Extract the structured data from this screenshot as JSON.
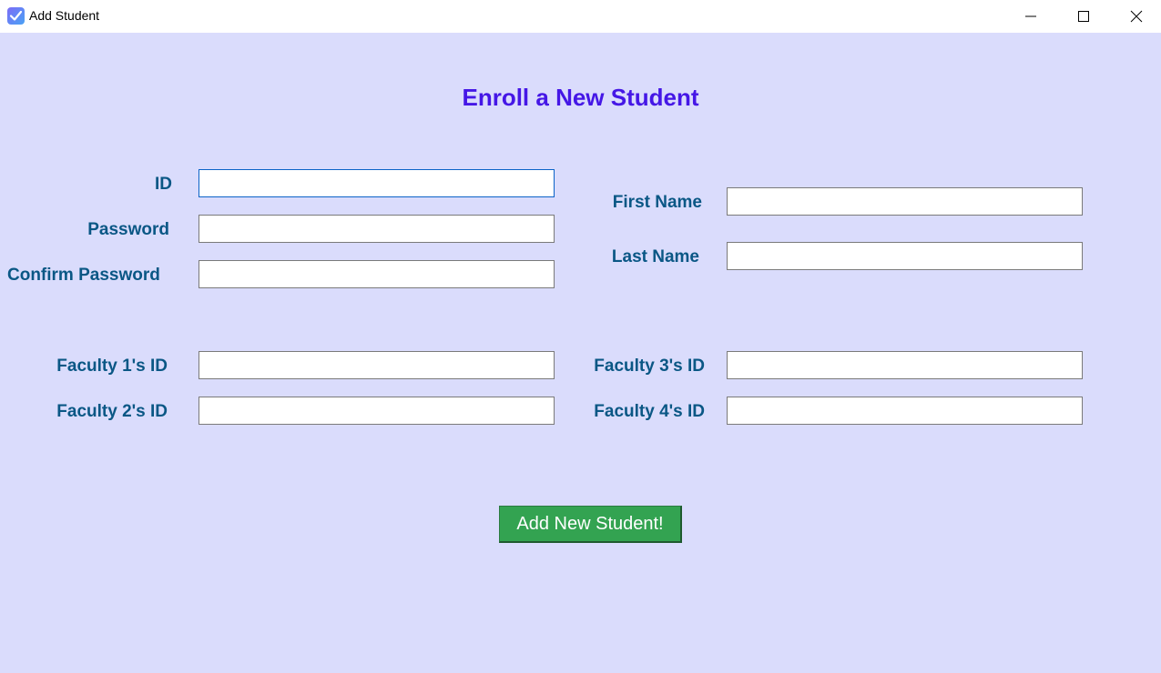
{
  "window": {
    "title": "Add Student",
    "icon": "checkbox-app-icon"
  },
  "form": {
    "heading": "Enroll a New Student",
    "id_label": "ID",
    "id_value": "",
    "password_label": "Password",
    "password_value": "",
    "confirm_password_label": "Confirm Password",
    "confirm_password_value": "",
    "first_name_label": "First Name",
    "first_name_value": "",
    "last_name_label": "Last Name",
    "last_name_value": "",
    "faculty1_label": "Faculty 1's ID",
    "faculty1_value": "",
    "faculty2_label": "Faculty 2's ID",
    "faculty2_value": "",
    "faculty3_label": "Faculty 3's ID",
    "faculty3_value": "",
    "faculty4_label": "Faculty 4's ID",
    "faculty4_value": "",
    "submit_label": "Add New Student!"
  },
  "colors": {
    "background": "#dadcfc",
    "heading": "#4517e6",
    "label": "#0a5785",
    "button": "#33a351"
  }
}
